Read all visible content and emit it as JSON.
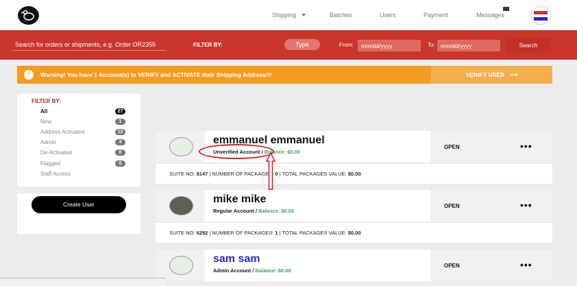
{
  "nav": {
    "items": [
      "Shipping",
      "Batches",
      "Users",
      "Payment",
      "Messages"
    ],
    "logo_icon": "bird-logo-icon",
    "profile_icon": "profile-logo-icon"
  },
  "filterbar": {
    "search_placeholder": "Search for orders or shipments, e.g. Order OR2355",
    "filter_by": "FILTER BY:",
    "type_label": "Type",
    "from_label": "From:",
    "to_label": "To:",
    "date_placeholder": "mm/dd/yyyy",
    "search_label": "Search"
  },
  "warning": {
    "icon": "exclamation-icon",
    "text": "Warning! You have 1 Account(s) to VERIFY and ACTIVATE their Shipping Address!!!",
    "button": "VERIFY USER",
    "button_icon": "arrow-right-icon"
  },
  "sidebar": {
    "title": "FILTER BY:",
    "items": [
      {
        "label": "All",
        "count": "27"
      },
      {
        "label": "New",
        "count": "1"
      },
      {
        "label": "Address Activated",
        "count": "13"
      },
      {
        "label": "Admin",
        "count": "4"
      },
      {
        "label": "De-Activated",
        "count": "0"
      },
      {
        "label": "Flagged",
        "count": "0"
      },
      {
        "label": "Staff Access",
        "count": ""
      }
    ],
    "create_button": "Create User"
  },
  "users": [
    {
      "name": "emmanuel emmanuel",
      "account": "Unverified Account /",
      "balance": "Balance: $0.00",
      "status": "OPEN",
      "suite_label": "SUITE NO:",
      "suite": "8147",
      "packages_label": "| NUMBER OF PACKAGES:",
      "packages": "0",
      "value_label": "| TOTAL PACKAGES VALUE:",
      "value": "$0.00"
    },
    {
      "name": "mike mike",
      "account": "Regular Account /",
      "balance": "Balance: $0.00",
      "status": "OPEN",
      "suite_label": "SUITE NO:",
      "suite": "6292",
      "packages_label": "| NUMBER OF PACKAGES:",
      "packages": "1",
      "value_label": "| TOTAL PACKAGES VALUE:",
      "value": "$0.00"
    },
    {
      "name": "sam sam",
      "account": "Admin Account /",
      "balance": "Balance: $0.00",
      "status": "OPEN"
    }
  ],
  "colors": {
    "brand_red": "#c9362b",
    "warning_orange": "#f39c1f",
    "balance_green": "#3aa35f",
    "admin_blue": "#1e2ccf"
  }
}
